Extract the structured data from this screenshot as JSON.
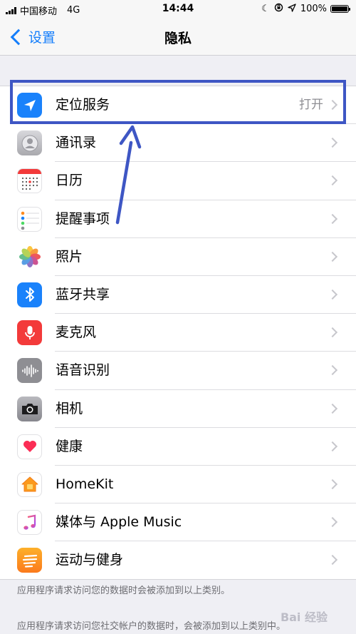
{
  "status_bar": {
    "carrier": "中国移动",
    "network": "4G",
    "time": "14:44",
    "battery_percent": "100%",
    "icons": [
      "moon-icon",
      "rotation-lock-icon",
      "location-arrow-icon"
    ]
  },
  "nav": {
    "back_label": "设置",
    "title": "隐私"
  },
  "rows": [
    {
      "label": "定位服务",
      "value": "打开",
      "icon": "location-arrow-icon",
      "color": "#1a82fb"
    },
    {
      "label": "通讯录",
      "value": "",
      "icon": "contacts-icon",
      "color": "#bdbdc2"
    },
    {
      "label": "日历",
      "value": "",
      "icon": "calendar-icon",
      "color": "#ffffff"
    },
    {
      "label": "提醒事项",
      "value": "",
      "icon": "reminders-icon",
      "color": "#ffffff"
    },
    {
      "label": "照片",
      "value": "",
      "icon": "photos-icon",
      "color": "#ffffff"
    },
    {
      "label": "蓝牙共享",
      "value": "",
      "icon": "bluetooth-icon",
      "color": "#1a82fb"
    },
    {
      "label": "麦克风",
      "value": "",
      "icon": "microphone-icon",
      "color": "#f33a3a"
    },
    {
      "label": "语音识别",
      "value": "",
      "icon": "speech-recognition-icon",
      "color": "#8e8e93"
    },
    {
      "label": "相机",
      "value": "",
      "icon": "camera-icon",
      "color": "#8e8e93"
    },
    {
      "label": "健康",
      "value": "",
      "icon": "health-heart-icon",
      "color": "#ffffff"
    },
    {
      "label": "HomeKit",
      "value": "",
      "icon": "home-icon",
      "color": "#ffffff"
    },
    {
      "label": "媒体与 Apple Music",
      "value": "",
      "icon": "music-note-icon",
      "color": "#ffffff"
    },
    {
      "label": "运动与健身",
      "value": "",
      "icon": "motion-fitness-icon",
      "color": "#fd8a1e"
    }
  ],
  "footer": {
    "note1": "应用程序请求访问您的数据时会被添加到以上类别。",
    "note2": "应用程序请求访问您社交帐户的数据时，会被添加到以上类别中。"
  },
  "watermark": "Bai 经验",
  "annotation_color": "#3e56c4"
}
